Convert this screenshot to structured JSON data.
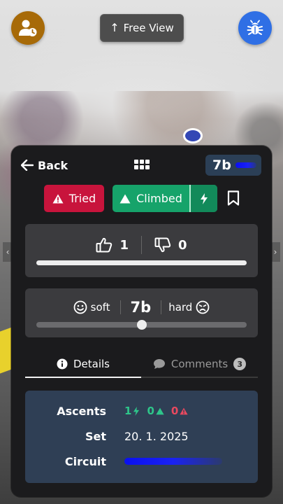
{
  "top": {
    "free_view_label": "Free View",
    "user_button_icon": "user-clock-icon",
    "bug_button_icon": "bug-icon",
    "user_button_color": "#a76a08",
    "bug_button_color": "#2f6fe5"
  },
  "panel": {
    "back_label": "Back",
    "grade": "7b",
    "grade_color": "#0a0ff0",
    "actions": {
      "tried_label": "Tried",
      "tried_color": "#c8143c",
      "climbed_label": "Climbed",
      "climbed_color": "#16a36a"
    },
    "likes": {
      "up_count": "1",
      "down_count": "0",
      "up_fraction": 1.0
    },
    "difficulty": {
      "soft_label": "soft",
      "grade": "7b",
      "hard_label": "hard",
      "slider_fraction": 0.5
    },
    "tabs": {
      "details_label": "Details",
      "comments_label": "Comments",
      "comments_count": "3"
    },
    "details": {
      "ascents_label": "Ascents",
      "ascents_flash": "1",
      "ascents_climbed": "0",
      "ascents_tried": "0",
      "set_label": "Set",
      "set_value": "20. 1. 2025",
      "circuit_label": "Circuit",
      "circuit_color": "#0a10f0"
    }
  }
}
